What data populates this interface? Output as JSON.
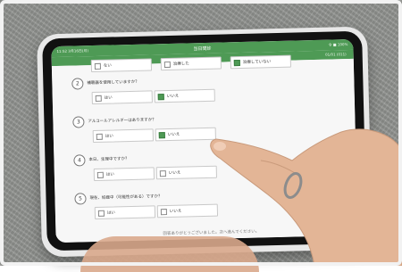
{
  "statusbar": {
    "left": "11:52 3月16日(月)",
    "title": "当日問診",
    "right": "令 ■ 100%"
  },
  "navbar": {
    "sub": "01/01 (011)"
  },
  "top_row": {
    "options": [
      {
        "label": "ない",
        "checked": false
      },
      {
        "label": "治療した",
        "checked": false
      },
      {
        "label": "治療していない",
        "checked": true
      }
    ]
  },
  "questions": [
    {
      "num": "2",
      "text": "補聴器を使用していますか？",
      "options": [
        {
          "label": "はい",
          "checked": false
        },
        {
          "label": "いいえ",
          "checked": true
        }
      ]
    },
    {
      "num": "3",
      "text": "アルコールアレルギーはありますか？",
      "options": [
        {
          "label": "はい",
          "checked": false
        },
        {
          "label": "いいえ",
          "checked": true
        }
      ]
    },
    {
      "num": "4",
      "text": "本日、生理中ですか？",
      "options": [
        {
          "label": "はい",
          "checked": false
        },
        {
          "label": "いいえ",
          "checked": false
        }
      ]
    },
    {
      "num": "5",
      "text": "現在、妊娠中（可能性がある）ですか？",
      "options": [
        {
          "label": "はい",
          "checked": false
        },
        {
          "label": "いいえ",
          "checked": false
        }
      ]
    }
  ],
  "footer_text": "回答ありがとうございました。次へ進んでください。",
  "colors": {
    "accent": "#4e9a55",
    "screen_bg": "#f7f7f7",
    "skin": "#e3b596"
  }
}
